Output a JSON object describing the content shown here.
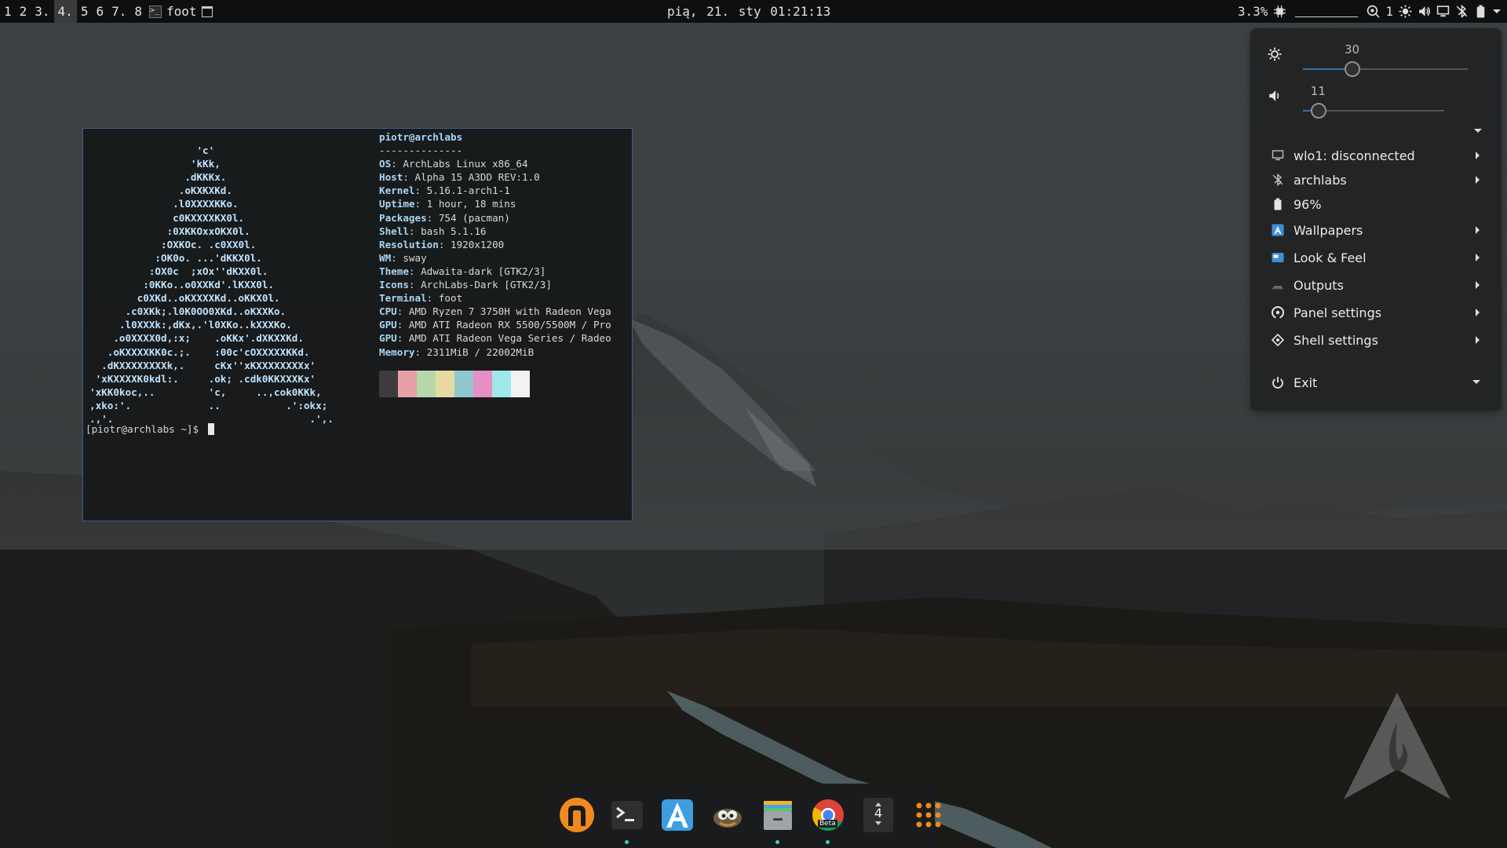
{
  "panel": {
    "workspaces": [
      "1",
      "2",
      "3.",
      "4.",
      "5",
      "6",
      "7.",
      "8"
    ],
    "active_workspace": "4.",
    "task_title": "foot",
    "datetime": "pią, 21. sty  01:21:13",
    "cpu": "3.3%",
    "notification_count": "1",
    "icons": [
      "cpu-icon",
      "notification-icon",
      "brightness-icon",
      "volume-icon",
      "network-icon",
      "bluetooth-icon",
      "battery-icon",
      "menu-caret-icon"
    ]
  },
  "terminal": {
    "logo_lines": [
      "                  'c'",
      "                 'kKk,",
      "                .dKKKx.",
      "               .oKXKXKd.",
      "              .l0XXXXKKo.",
      "              c0KXXXXKX0l.",
      "             :0XKKOxxOKX0l.",
      "            :OXKOc. .c0XX0l.",
      "           :OK0o. ...'dKKX0l.",
      "          :OX0c  ;xOx''dKXX0l.",
      "         :0KKo..o0XXKd'.lKXX0l.",
      "        c0XKd..oKXXXXKd..oKKX0l.",
      "      .c0XKk;.l0K0OO0XKd..oKXXKo.",
      "     .l0XXXk:,dKx,.'l0XKo..kXXXKo.",
      "    .o0XXXX0d,:x;    .oKKx'.dXKXXKd.",
      "   .oKXXXXKK0c.;.    :00c'cOXXXXXKKd.",
      "  .dKXXXXXXXXk,.     cKx''xKXXXXXXXXx'",
      " 'xKXXXXK0kdl:.     .ok; .cdk0KKXXXKx'",
      "'xKK0koc,..         'c,     ..,cok0KKk,",
      ",xko:'.             ..           .':okx;",
      ".,'.                                 .',."
    ],
    "user_host": "piotr@archlabs",
    "separator": "--------------",
    "info": [
      {
        "key": "OS",
        "value": "ArchLabs Linux x86_64"
      },
      {
        "key": "Host",
        "value": "Alpha 15 A3DD REV:1.0"
      },
      {
        "key": "Kernel",
        "value": "5.16.1-arch1-1"
      },
      {
        "key": "Uptime",
        "value": "1 hour, 18 mins"
      },
      {
        "key": "Packages",
        "value": "754 (pacman)"
      },
      {
        "key": "Shell",
        "value": "bash 5.1.16"
      },
      {
        "key": "Resolution",
        "value": "1920x1200"
      },
      {
        "key": "WM",
        "value": "sway"
      },
      {
        "key": "Theme",
        "value": "Adwaita-dark [GTK2/3]"
      },
      {
        "key": "Icons",
        "value": "ArchLabs-Dark [GTK2/3]"
      },
      {
        "key": "Terminal",
        "value": "foot"
      },
      {
        "key": "CPU",
        "value": "AMD Ryzen 7 3750H with Radeon Vega"
      },
      {
        "key": "GPU",
        "value": "AMD ATI Radeon RX 5500/5500M / Pro"
      },
      {
        "key": "GPU",
        "value": "AMD ATI Radeon Vega Series / Radeo"
      },
      {
        "key": "Memory",
        "value": "2311MiB / 22002MiB"
      }
    ],
    "palette": [
      "#3c3c3c",
      "#e89fa8",
      "#b6d7a8",
      "#e8d9a2",
      "#8fc8cf",
      "#e58fc3",
      "#9fe7ec",
      "#f2f2f2"
    ],
    "prompt": "[piotr@archlabs ~]$ "
  },
  "menu": {
    "brightness": {
      "value": "30",
      "level": 30
    },
    "volume": {
      "value": "11",
      "level": 11
    },
    "items": [
      {
        "label": "wlo1: disconnected",
        "icon": "monitor-icon",
        "submenu": true
      },
      {
        "label": "archlabs",
        "icon": "bluetooth-icon",
        "submenu": true
      },
      {
        "label": "96%",
        "icon": "battery-icon",
        "submenu": false
      },
      {
        "label": "Wallpapers",
        "icon": "wallpapers-icon",
        "submenu": true
      },
      {
        "label": "Look & Feel",
        "icon": "look-feel-icon",
        "submenu": true
      },
      {
        "label": "Outputs",
        "icon": "outputs-icon",
        "submenu": true
      },
      {
        "label": "Panel settings",
        "icon": "panel-settings-icon",
        "submenu": true
      },
      {
        "label": "Shell settings",
        "icon": "shell-settings-icon",
        "submenu": true
      }
    ],
    "exit_label": "Exit"
  },
  "dock": {
    "apps": [
      "nwg-launcher-icon",
      "terminal-icon",
      "archlabs-installer-icon",
      "gimp-icon",
      "file-manager-icon",
      "chrome-beta-icon",
      "workspace-switcher-icon",
      "app-grid-icon"
    ],
    "workspace_number": "4",
    "chrome_badge": "Beta"
  }
}
